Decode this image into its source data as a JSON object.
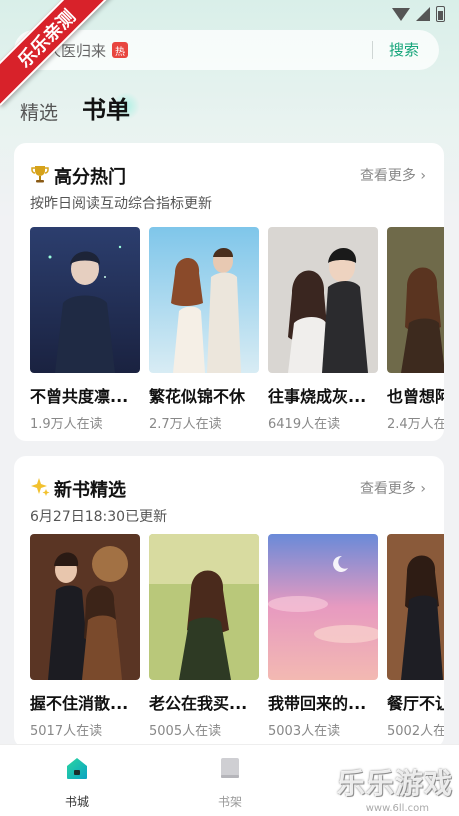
{
  "ribbon": "乐乐亲测",
  "search": {
    "query": "人医归来",
    "hot_badge": "热",
    "button_label": "搜索"
  },
  "tabs": [
    {
      "label": "精选"
    },
    {
      "label": "书单"
    }
  ],
  "sections": [
    {
      "title": "高分热门",
      "icon": "trophy-icon",
      "subtitle": "按昨日阅读互动综合指标更新",
      "more_label": "查看更多",
      "books": [
        {
          "title": "不曾共度凛...",
          "readers": "1.9万人在读"
        },
        {
          "title": "繁花似锦不休",
          "readers": "2.7万人在读"
        },
        {
          "title": "往事烧成灰...",
          "readers": "6419人在读"
        },
        {
          "title": "也曾想阿",
          "readers": "2.4万人在"
        }
      ]
    },
    {
      "title": "新书精选",
      "icon": "sparkle-icon",
      "subtitle": "6月27日18:30已更新",
      "more_label": "查看更多",
      "books": [
        {
          "title": "握不住消散...",
          "readers": "5017人在读"
        },
        {
          "title": "老公在我买...",
          "readers": "5005人在读"
        },
        {
          "title": "我带回来的...",
          "readers": "5003人在读"
        },
        {
          "title": "餐厅不让",
          "readers": "5002人在"
        }
      ]
    }
  ],
  "bottom_nav": [
    {
      "label": "书城",
      "icon": "home-icon",
      "active": true
    },
    {
      "label": "书架",
      "icon": "bookshelf-icon",
      "active": false
    }
  ],
  "watermark": {
    "text": "乐乐游戏",
    "url": "www.6ll.com"
  },
  "colors": {
    "accent": "#16a57a",
    "hot": "#e8463f",
    "ribbon": "#d8222a"
  }
}
